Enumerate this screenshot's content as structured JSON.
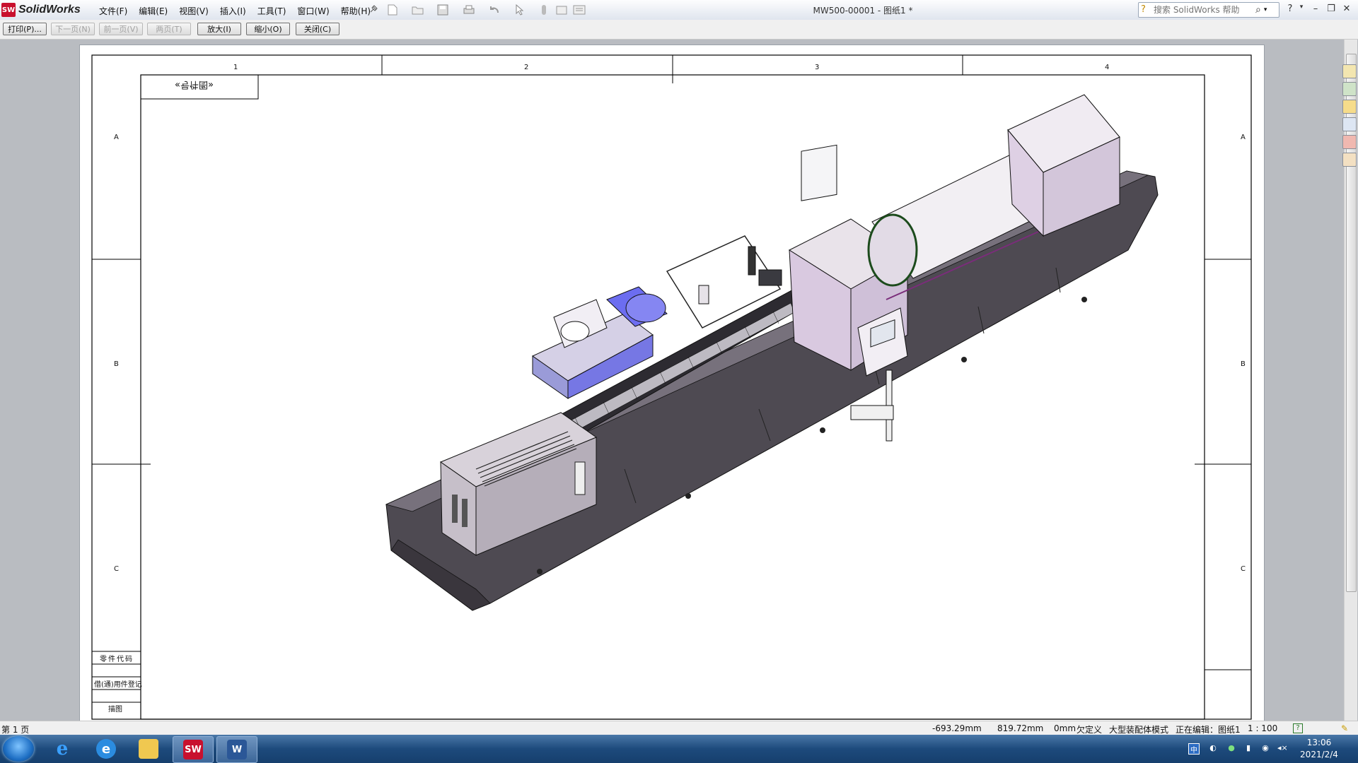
{
  "app": {
    "logo_text": "SolidWorks",
    "doc_title": "MW500-00001 - 图纸1 *"
  },
  "menu": [
    "文件(F)",
    "编辑(E)",
    "视图(V)",
    "插入(I)",
    "工具(T)",
    "窗口(W)",
    "帮助(H)"
  ],
  "search": {
    "placeholder": "搜索 SolidWorks 帮助"
  },
  "print_toolbar": {
    "print": "打印(P)...",
    "next_page": "下一页(N)",
    "prev_page": "前一页(V)",
    "two_pages": "两页(T)",
    "zoom_in": "放大(I)",
    "zoom_out": "缩小(O)",
    "close": "关闭(C)"
  },
  "drawing": {
    "columns": [
      "1",
      "2",
      "3",
      "4"
    ],
    "rows": [
      "A",
      "B",
      "C"
    ],
    "tag": "«号件图»",
    "side_labels": [
      "零件代码",
      "借(通)用件登记",
      "描图"
    ]
  },
  "status": {
    "page": "第 1 页",
    "x": "-693.29mm",
    "y": "819.72mm",
    "z": "0mm",
    "state": "欠定义",
    "mode": "大型装配体模式",
    "editing": "正在编辑：图纸1",
    "scale": "1 : 100"
  },
  "clock": {
    "time": "13:06",
    "date": "2021/2/4"
  },
  "colors": {
    "machine_body": "#56515a",
    "machine_light": "#e9e3ea",
    "blue_part": "#6c6df0",
    "title_red": "#c8102e"
  }
}
